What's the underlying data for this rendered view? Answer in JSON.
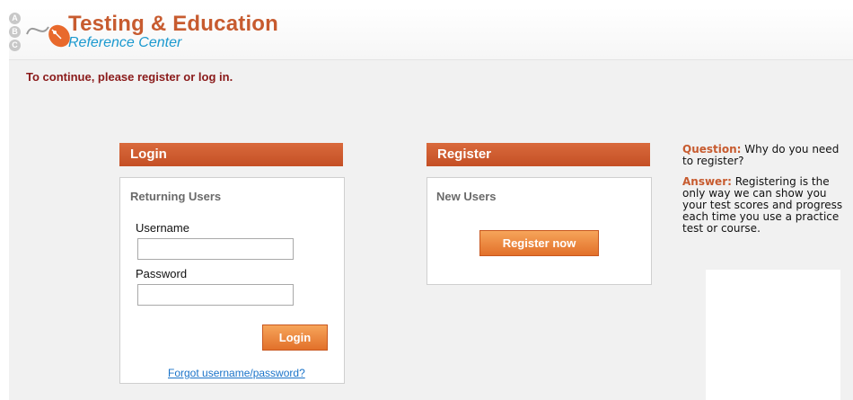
{
  "header": {
    "title": "Testing & Education",
    "subtitle": "Reference Center",
    "logo_letters": [
      "A",
      "B",
      "C"
    ]
  },
  "prompt": "To continue, please register or log in.",
  "login": {
    "heading": "Login",
    "section_title": "Returning Users",
    "username_label": "Username",
    "username_value": "",
    "password_label": "Password",
    "password_value": "",
    "button_label": "Login",
    "forgot_link": "Forgot username/password?"
  },
  "register": {
    "heading": "Register",
    "section_title": "New Users",
    "button_label": "Register now"
  },
  "sidebar": {
    "question_label": "Question:",
    "question_text": "Why do you need to register?",
    "answer_label": "Answer:",
    "answer_text": "Registering is the only way we can show you your test scores and progress each time you use a practice test or course."
  },
  "colors": {
    "accent": "#c75b2f",
    "header_bar": "#cf5c2e",
    "button": "#ec8439",
    "link": "#1a73c9",
    "prompt": "#8a1a1a",
    "logo_subtitle": "#1b99cf"
  }
}
